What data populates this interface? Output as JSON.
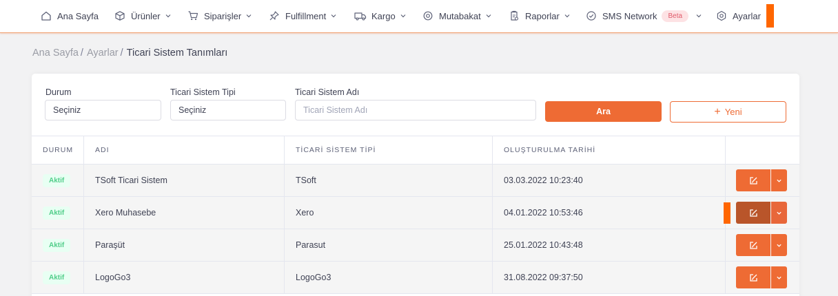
{
  "nav": {
    "items": [
      {
        "label": "Ana Sayfa",
        "icon": "home-icon",
        "has_dropdown": false
      },
      {
        "label": "Ürünler",
        "icon": "box-icon",
        "has_dropdown": true
      },
      {
        "label": "Siparişler",
        "icon": "cart-icon",
        "has_dropdown": true
      },
      {
        "label": "Fulfillment",
        "icon": "pin-icon",
        "has_dropdown": true
      },
      {
        "label": "Kargo",
        "icon": "truck-icon",
        "has_dropdown": true
      },
      {
        "label": "Mutabakat",
        "icon": "target-icon",
        "has_dropdown": true
      },
      {
        "label": "Raporlar",
        "icon": "report-icon",
        "has_dropdown": true
      },
      {
        "label": "SMS Network",
        "icon": "check-circle-icon",
        "has_dropdown": true,
        "badge": "Beta"
      },
      {
        "label": "Ayarlar",
        "icon": "settings-hex-icon",
        "has_dropdown": false
      }
    ]
  },
  "breadcrumb": {
    "items": [
      "Ana Sayfa",
      "Ayarlar"
    ],
    "current": "Ticari Sistem Tanımları",
    "separator": "/"
  },
  "filters": {
    "durum": {
      "label": "Durum",
      "value": "Seçiniz"
    },
    "tip": {
      "label": "Ticari Sistem Tipi",
      "value": "Seçiniz"
    },
    "ad": {
      "label": "Ticari Sistem Adı",
      "placeholder": "Ticari Sistem Adı"
    },
    "search_label": "Ara",
    "new_label": "Yeni",
    "new_icon": "+"
  },
  "table": {
    "headers": [
      "DURUM",
      "ADI",
      "TİCARİ SİSTEM TİPİ",
      "OLUŞTURULMA TARİHİ",
      ""
    ],
    "rows": [
      {
        "status": "Aktif",
        "name": "TSoft Ticari Sistem",
        "type": "TSoft",
        "created": "03.03.2022 10:23:40"
      },
      {
        "status": "Aktif",
        "name": "Xero Muhasebe",
        "type": "Xero",
        "created": "04.01.2022 10:53:46"
      },
      {
        "status": "Aktif",
        "name": "Paraşüt",
        "type": "Parasut",
        "created": "25.01.2022 10:43:48"
      },
      {
        "status": "Aktif",
        "name": "LogoGo3",
        "type": "LogoGo3",
        "created": "31.08.2022 09:37:50"
      }
    ]
  },
  "colors": {
    "accent": "#ee6b34",
    "accent_dark": "#b9552a",
    "marker": "#ff6600",
    "badge_bg": "#e8fff3",
    "badge_text": "#50cd89"
  }
}
